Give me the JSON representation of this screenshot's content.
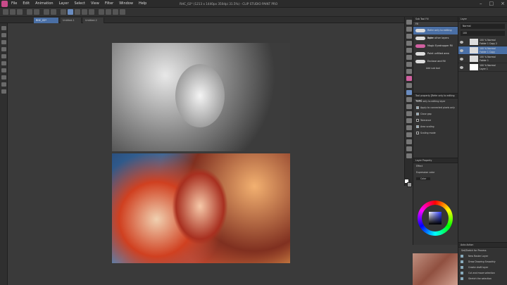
{
  "window": {
    "title": "RHC_02* (1213 x 1440px 350dpi 31.5%) - CLIP STUDIO PAINT PRO",
    "menus": [
      "File",
      "Edit",
      "Animation",
      "Layer",
      "Select",
      "View",
      "Filter",
      "Window",
      "Help"
    ]
  },
  "tabs": [
    {
      "label": "RHC_02*",
      "active": true
    },
    {
      "label": "Untitled-1",
      "active": false
    },
    {
      "label": "Untitled-2",
      "active": false
    }
  ],
  "subtool": {
    "header": "Sub Tool Fill",
    "group": "Fill",
    "items": [
      {
        "label": "Refer only to editing layer",
        "selected": true
      },
      {
        "label": "Refer other layers",
        "selected": false
      },
      {
        "label": "Magic Eyedropper Fill",
        "selected": false
      },
      {
        "label": "Paint unfilled area",
        "selected": false
      },
      {
        "label": "Enclose and fill",
        "selected": false
      }
    ],
    "add_label": "Add sub tool"
  },
  "tool_property": {
    "header": "Tool property [Refer only to editing layer]",
    "name": "Refer only to editing layer",
    "rows": [
      {
        "label": "Apply to connected pixels only",
        "checked": true
      },
      {
        "label": "Close gap",
        "checked": true
      },
      {
        "label": "Tolerance",
        "checked": false
      },
      {
        "label": "Area scaling",
        "checked": true
      },
      {
        "label": "Scaling mode",
        "checked": false
      }
    ]
  },
  "color": {
    "header": "Layer Property",
    "effect_label": "Effect",
    "expression_label": "Expression color",
    "expression_value": "Color"
  },
  "layers": {
    "header": "Layer",
    "blend_mode": "Normal",
    "opacity": "100",
    "items": [
      {
        "name": "100 % Normal",
        "sub": "Folder 1 Copy 2",
        "selected": false
      },
      {
        "name": "100 % Normal",
        "sub": "Folder 1 Copy",
        "selected": true
      },
      {
        "name": "100 % Normal",
        "sub": "Folder 1",
        "selected": false
      },
      {
        "name": "100 % Normal",
        "sub": "Layer 1",
        "selected": false
      }
    ]
  },
  "auto_action": {
    "header": "Auto Action",
    "set": "Set/Sketch for Process",
    "items": [
      "New Raster Layer",
      "Draw Drawing Smoothly",
      "Create draft layer",
      "Cut and move selection",
      "Stretch the selection"
    ]
  }
}
